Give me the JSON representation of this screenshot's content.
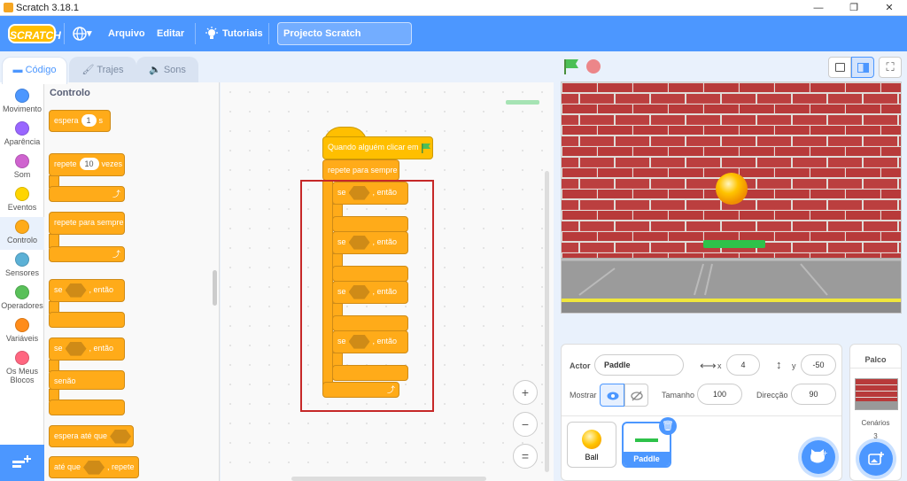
{
  "window": {
    "title": "Scratch 3.18.1",
    "min": "—",
    "max": "❐",
    "close": "✕"
  },
  "menu": {
    "logo": "SCRATCH",
    "file": "Arquivo",
    "edit": "Editar",
    "tutorials": "Tutoriais",
    "project_title": "Projecto Scratch",
    "globe_caret": "▾"
  },
  "tabs": {
    "code": "Código",
    "costumes": "Trajes",
    "sounds": "Sons"
  },
  "categories": [
    {
      "label": "Movimento",
      "color": "#4c97ff"
    },
    {
      "label": "Aparência",
      "color": "#9966ff"
    },
    {
      "label": "Som",
      "color": "#cf63cf"
    },
    {
      "label": "Eventos",
      "color": "#ffd500"
    },
    {
      "label": "Controlo",
      "color": "#ffab19"
    },
    {
      "label": "Sensores",
      "color": "#5cb1d6"
    },
    {
      "label": "Operadores",
      "color": "#59c059"
    },
    {
      "label": "Variáveis",
      "color": "#ff8c1a"
    },
    {
      "label": "Os Meus Blocos",
      "color": "#ff6680"
    }
  ],
  "palette": {
    "heading": "Controlo",
    "wait_a": "espera",
    "wait_val": "1",
    "wait_b": "s",
    "repeat_a": "repete",
    "repeat_val": "10",
    "repeat_b": "vezes",
    "forever": "repete para sempre",
    "if_a": "se",
    "if_b": ", então",
    "ifelse_a": "se",
    "ifelse_b": ", então",
    "else": "senão",
    "waituntil": "espera até que",
    "until_a": "até que",
    "until_b": ", repete",
    "loop_arrow": "⤴"
  },
  "script": {
    "hat": "Quando alguém clicar em",
    "forever": "repete para sempre",
    "if_a": "se",
    "if_b": ", então",
    "loop_arrow": "⤴"
  },
  "zoom": {
    "in": "+",
    "out": "−",
    "reset": "="
  },
  "sprite_info": {
    "actor_label": "Actor",
    "actor": "Paddle",
    "x_label": "x",
    "x": "4",
    "y_label": "y",
    "y": "-50",
    "show_label": "Mostrar",
    "size_label": "Tamanho",
    "size": "100",
    "dir_label": "Direcção",
    "dir": "90"
  },
  "sprites": [
    {
      "name": "Ball"
    },
    {
      "name": "Paddle"
    }
  ],
  "stage_panel": {
    "title": "Palco",
    "backdrops_label": "Cenários",
    "backdrops": "3"
  },
  "colors": {
    "accent": "#4c97ff",
    "control": "#ffab19",
    "highlight": "#c62828"
  }
}
